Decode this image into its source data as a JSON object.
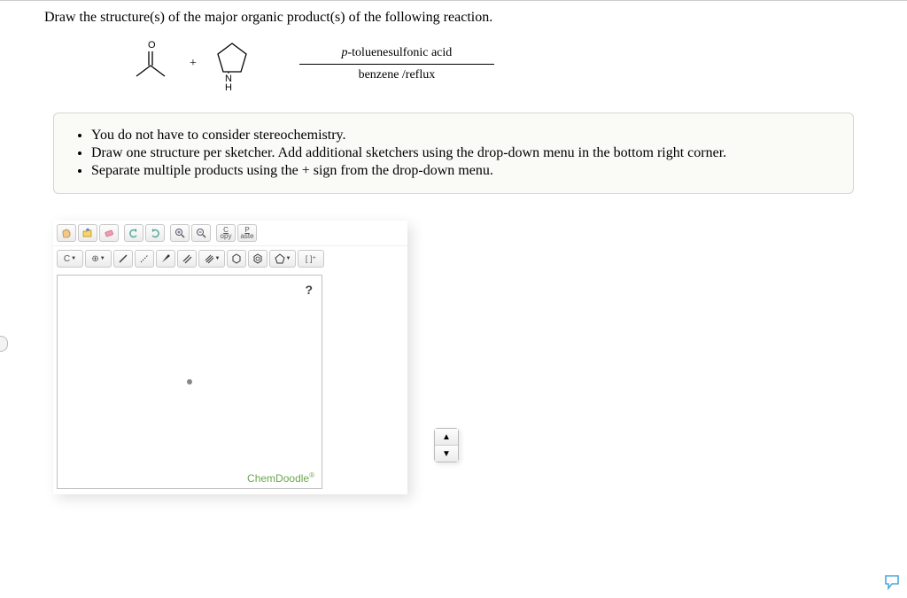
{
  "question": "Draw the structure(s) of the major organic product(s) of the following reaction.",
  "reaction": {
    "plus": "+",
    "arrow_top_prefix": "p",
    "arrow_top_rest": "-toluenesulfonic acid",
    "arrow_bottom": "benzene /reflux",
    "struct1_label_O": "O",
    "struct2_label_N": "N",
    "struct2_label_H": "H"
  },
  "instructions": [
    "You do not have to consider stereochemistry.",
    "Draw one structure per sketcher. Add additional sketchers using the drop-down menu in the bottom right corner.",
    "Separate multiple products using the + sign from the drop-down menu."
  ],
  "sketcher": {
    "copy_c": "C",
    "copy_opy": "opy",
    "paste_p": "P",
    "paste_aste": "aste",
    "element_label": "C",
    "charge_label": "⊕",
    "brackets": "[ ]⁺",
    "help": "?",
    "brand": "ChemDoodle",
    "brand_mark": "®",
    "spinner_up": "▲",
    "spinner_down": "▼"
  }
}
